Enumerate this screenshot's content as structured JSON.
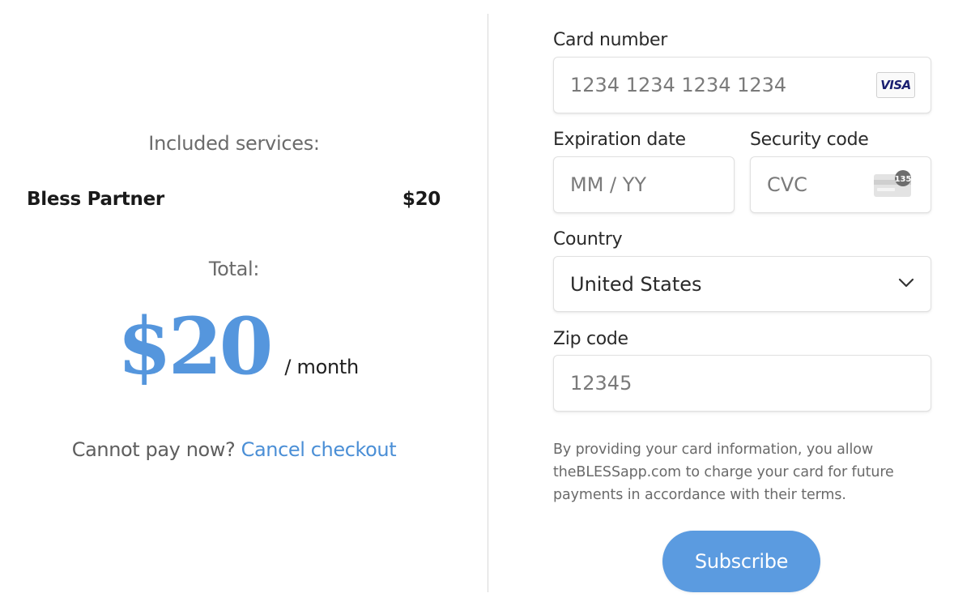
{
  "summary": {
    "included_heading": "Included services:",
    "services": [
      {
        "name": "Bless Partner",
        "price": "$20"
      }
    ],
    "total_heading": "Total:",
    "total_amount": "$20",
    "total_period": "/ month",
    "cancel_prompt": "Cannot pay now?",
    "cancel_link": "Cancel checkout"
  },
  "form": {
    "card_number": {
      "label": "Card number",
      "placeholder": "1234 1234 1234 1234",
      "brand_icon": "visa-icon",
      "brand_text": "VISA"
    },
    "expiration": {
      "label": "Expiration date",
      "placeholder": "MM / YY"
    },
    "security_code": {
      "label": "Security code",
      "placeholder": "CVC",
      "icon": "cvc-card-icon",
      "icon_text": "135"
    },
    "country": {
      "label": "Country",
      "selected": "United States",
      "icon": "chevron-down-icon"
    },
    "zip": {
      "label": "Zip code",
      "placeholder": "12345"
    },
    "disclaimer": "By providing your card information, you allow theBLESSapp.com to charge your card for future payments in accordance with their terms.",
    "subscribe_label": "Subscribe"
  },
  "colors": {
    "accent": "#5596dd",
    "link": "#4b8fd6",
    "button": "#5b9be0",
    "visa": "#1a1f71"
  }
}
